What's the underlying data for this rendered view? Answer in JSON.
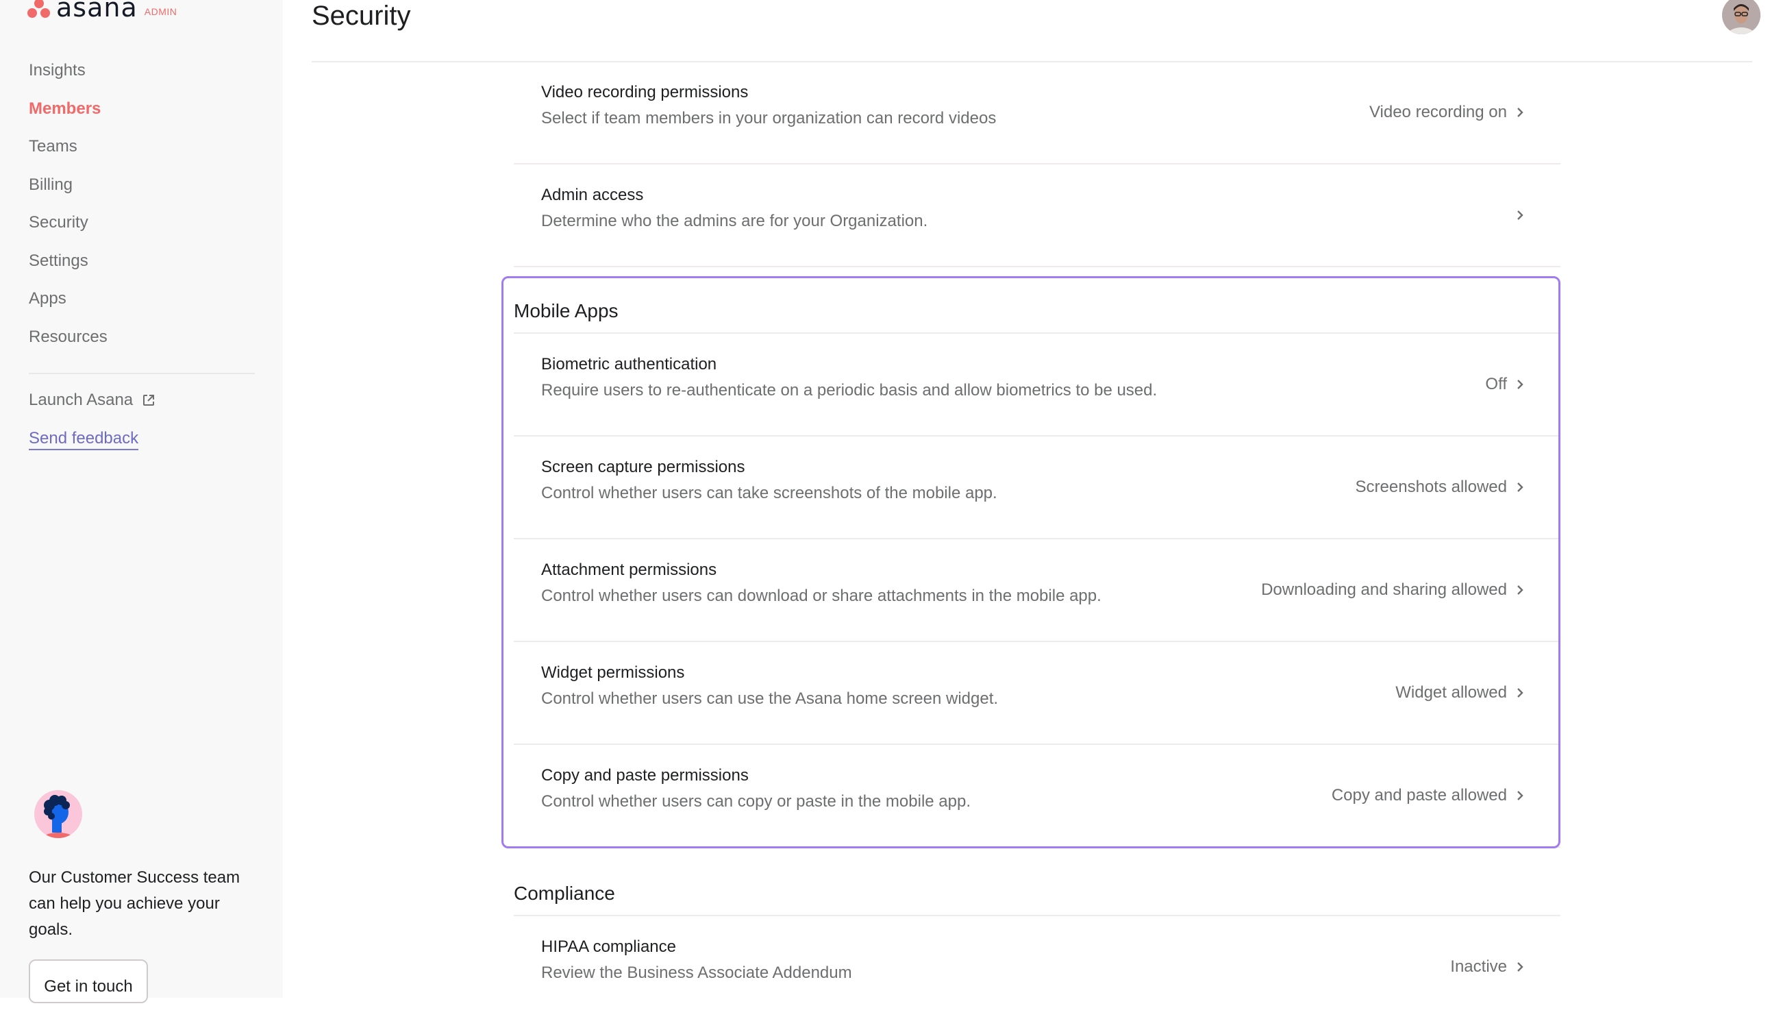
{
  "app": {
    "brand": "asana",
    "brand_badge": "ADMIN",
    "colors": {
      "brand": "#f06a6a",
      "highlight": "#a07cf0",
      "link": "#6d6bc3"
    }
  },
  "sidebar": {
    "items": [
      {
        "label": "Insights",
        "active": false
      },
      {
        "label": "Members",
        "active": true
      },
      {
        "label": "Teams",
        "active": false
      },
      {
        "label": "Billing",
        "active": false
      },
      {
        "label": "Security",
        "active": false
      },
      {
        "label": "Settings",
        "active": false
      },
      {
        "label": "Apps",
        "active": false
      },
      {
        "label": "Resources",
        "active": false
      }
    ],
    "launch_label": "Launch Asana",
    "launch_icon": "external-link-icon",
    "feedback_label": "Send feedback",
    "customer_success": {
      "text": "Our Customer Success team can help you achieve your goals.",
      "button_label": "Get in touch"
    }
  },
  "header": {
    "title": "Security",
    "avatar": "user-avatar"
  },
  "general_rows": [
    {
      "title": "Video recording permissions",
      "description": "Select if team members in your organization can record videos",
      "value": "Video recording on"
    },
    {
      "title": "Admin access",
      "description": "Determine who the admins are for your Organization.",
      "value": ""
    }
  ],
  "mobile_apps": {
    "title": "Mobile Apps",
    "rows": [
      {
        "title": "Biometric authentication",
        "description": "Require users to re-authenticate on a periodic basis and allow biometrics to be used.",
        "value": "Off"
      },
      {
        "title": "Screen capture permissions",
        "description": "Control whether users can take screenshots of the mobile app.",
        "value": "Screenshots allowed"
      },
      {
        "title": "Attachment permissions",
        "description": "Control whether users can download or share attachments in the mobile app.",
        "value": "Downloading and sharing allowed"
      },
      {
        "title": "Widget permissions",
        "description": "Control whether users can use the Asana home screen widget.",
        "value": "Widget allowed"
      },
      {
        "title": "Copy and paste permissions",
        "description": "Control whether users can copy or paste in the mobile app.",
        "value": "Copy and paste allowed"
      }
    ]
  },
  "compliance": {
    "title": "Compliance",
    "rows": [
      {
        "title": "HIPAA compliance",
        "description": "Review the Business Associate Addendum",
        "value": "Inactive"
      }
    ]
  }
}
